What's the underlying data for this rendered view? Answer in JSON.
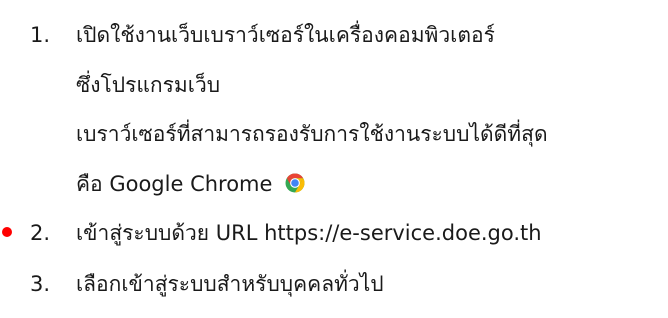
{
  "steps": [
    {
      "number": "1.",
      "lines": [
        "เปิดใช้งานเว็บเบราว์เซอร์ในเครื่องคอมพิวเตอร์",
        "ซึ่งโปรแกรมเว็บ",
        "เบราว์เซอร์ที่สามารถรองรับการใช้งานระบบได้ดีที่สุด",
        "คือ Google Chrome"
      ],
      "icon": "chrome-logo-icon"
    },
    {
      "number": "2.",
      "lines": [
        "เข้าสู่ระบบด้วย URL https://e-service.doe.go.th"
      ]
    },
    {
      "number": "3.",
      "lines": [
        "เลือกเข้าสู่ระบบสำหรับบุคคลทั่วไป"
      ]
    }
  ],
  "colors": {
    "text": "#1a1a1a",
    "marker": "#ff0000"
  }
}
